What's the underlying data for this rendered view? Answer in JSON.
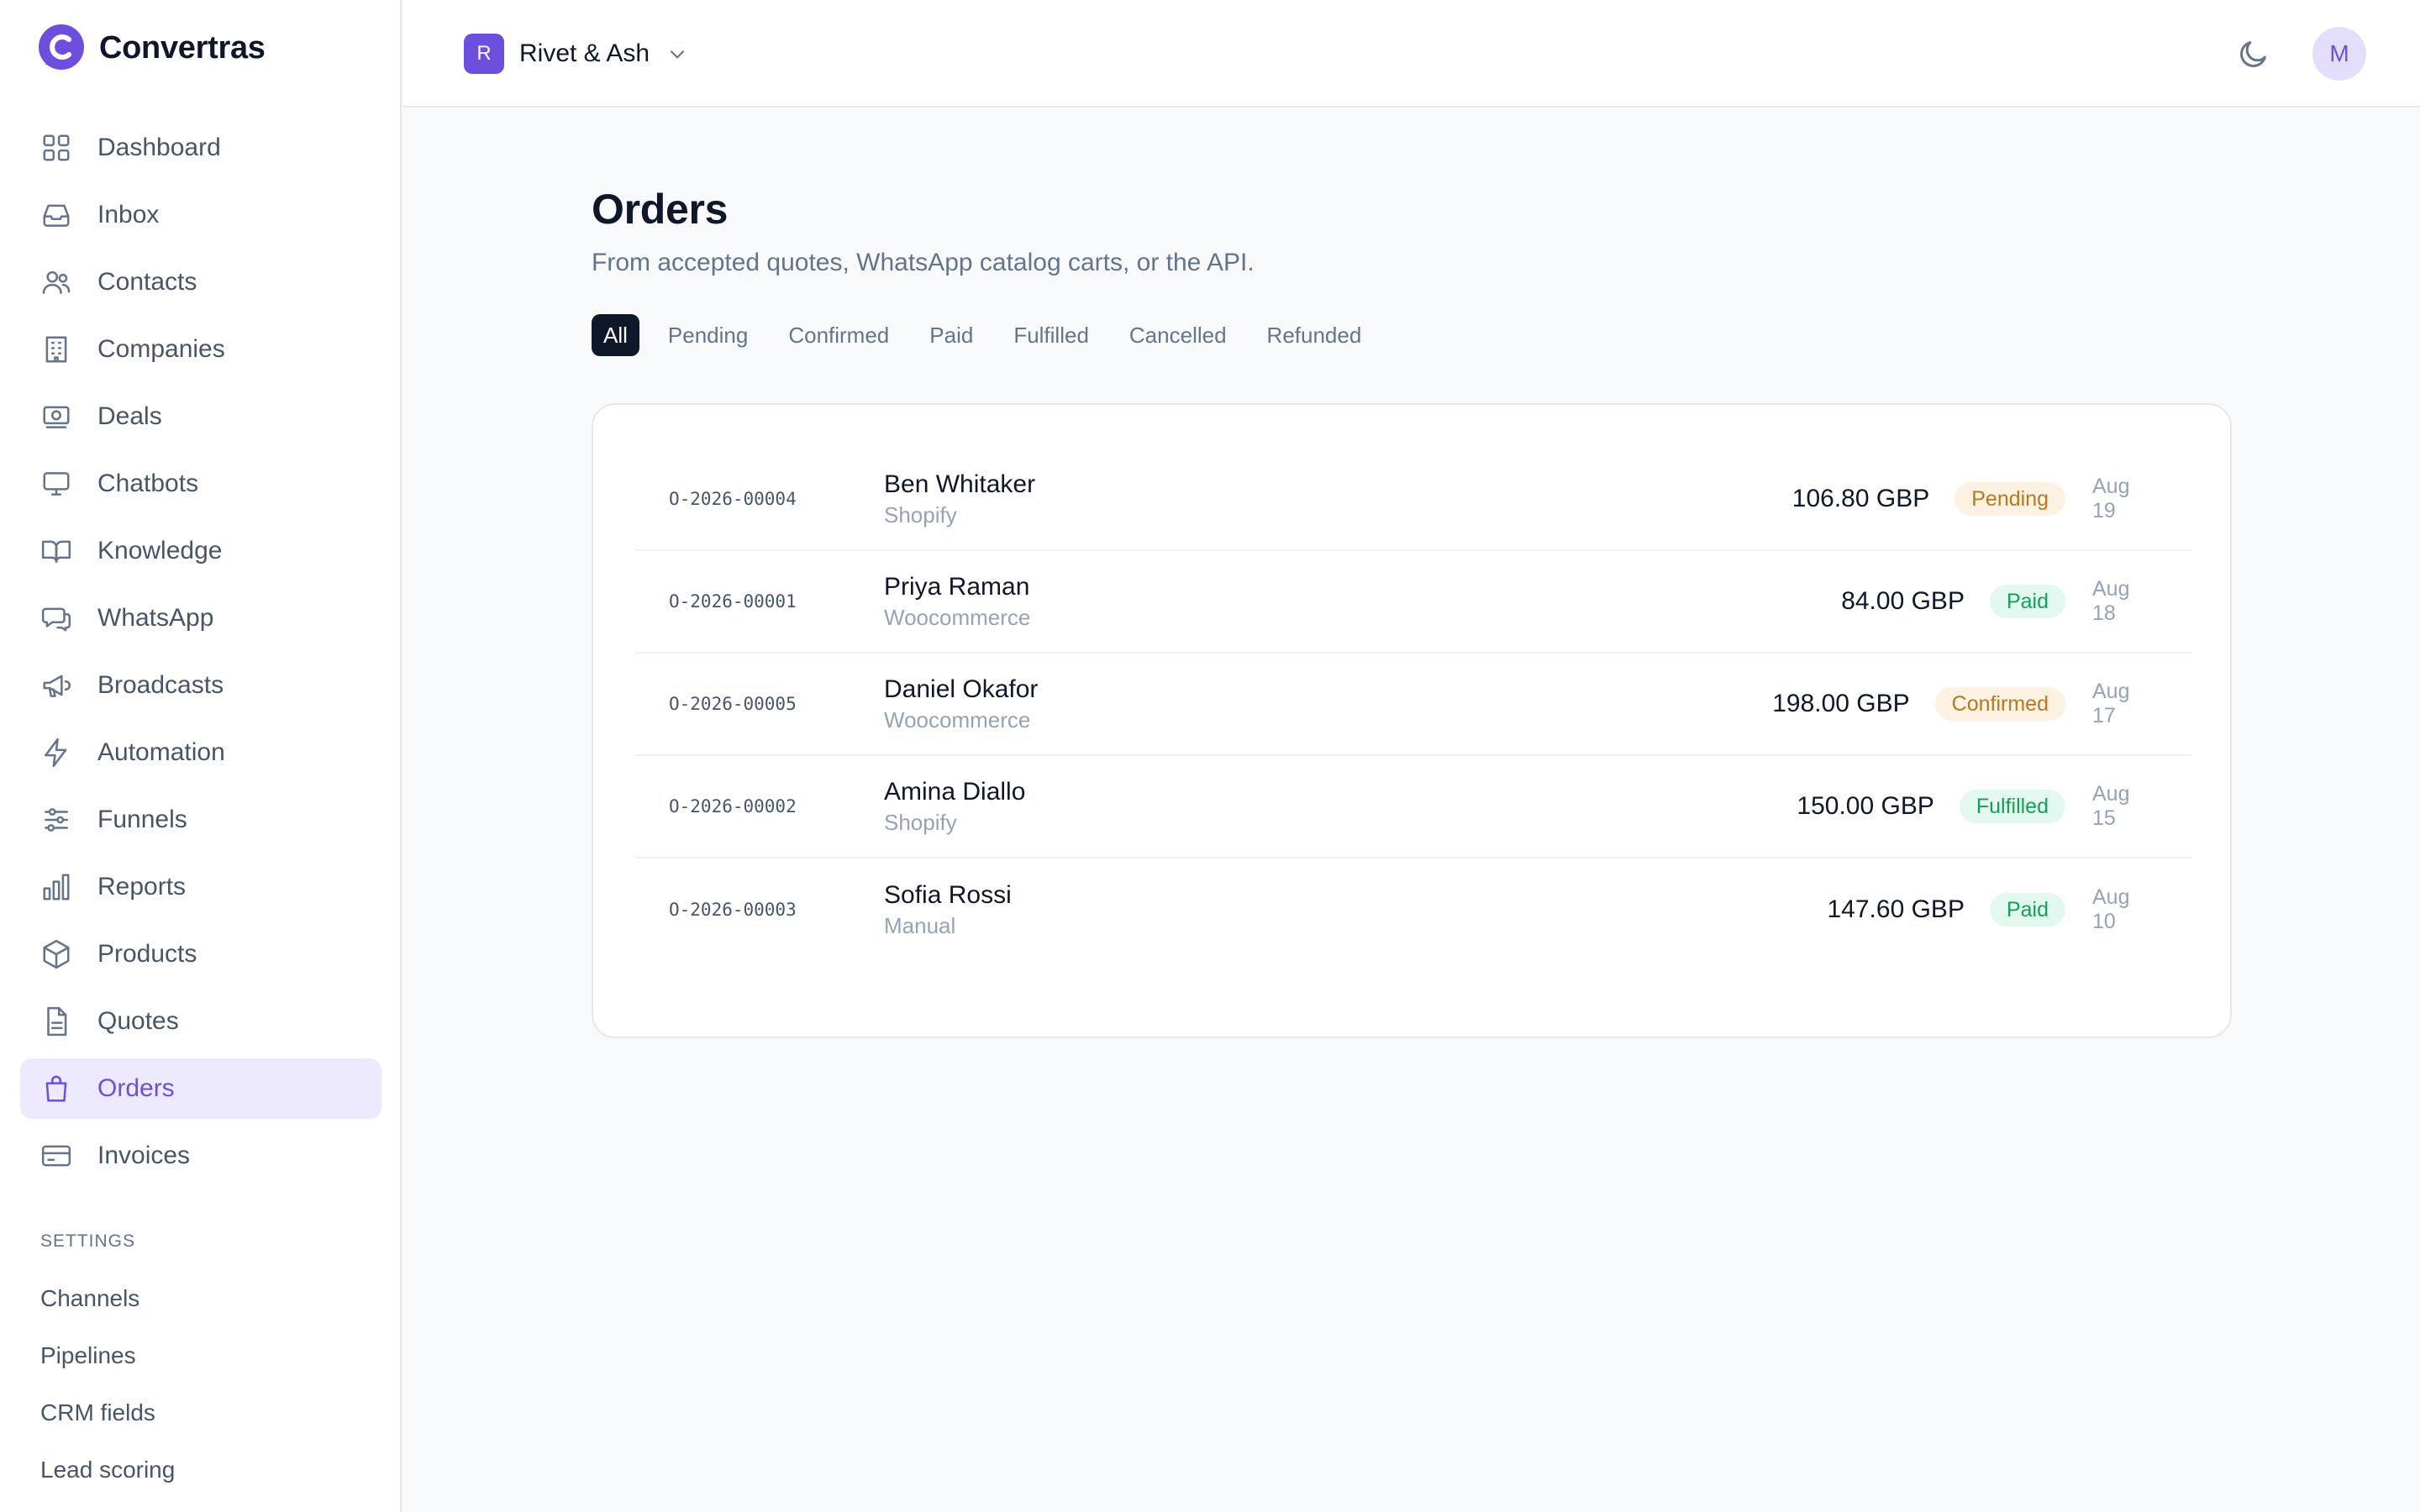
{
  "app": {
    "name": "Convertras"
  },
  "sidebar": {
    "items": [
      {
        "label": "Dashboard",
        "icon": "grid-icon"
      },
      {
        "label": "Inbox",
        "icon": "inbox-icon"
      },
      {
        "label": "Contacts",
        "icon": "users-icon"
      },
      {
        "label": "Companies",
        "icon": "building-icon"
      },
      {
        "label": "Deals",
        "icon": "money-icon"
      },
      {
        "label": "Chatbots",
        "icon": "monitor-icon"
      },
      {
        "label": "Knowledge",
        "icon": "book-icon"
      },
      {
        "label": "WhatsApp",
        "icon": "chat-icon"
      },
      {
        "label": "Broadcasts",
        "icon": "megaphone-icon"
      },
      {
        "label": "Automation",
        "icon": "lightning-icon"
      },
      {
        "label": "Funnels",
        "icon": "sliders-icon"
      },
      {
        "label": "Reports",
        "icon": "bar-chart-icon"
      },
      {
        "label": "Products",
        "icon": "box-icon"
      },
      {
        "label": "Quotes",
        "icon": "file-icon"
      },
      {
        "label": "Orders",
        "icon": "shopping-bag-icon",
        "active": true
      },
      {
        "label": "Invoices",
        "icon": "credit-card-icon"
      }
    ],
    "settings_title": "SETTINGS",
    "settings_items": [
      "Channels",
      "Pipelines",
      "CRM fields",
      "Lead scoring"
    ]
  },
  "topbar": {
    "workspace_initial": "R",
    "workspace_name": "Rivet & Ash",
    "avatar_initial": "M"
  },
  "page": {
    "title": "Orders",
    "subtitle": "From accepted quotes, WhatsApp catalog carts, or the API."
  },
  "tabs": [
    "All",
    "Pending",
    "Confirmed",
    "Paid",
    "Fulfilled",
    "Cancelled",
    "Refunded"
  ],
  "active_tab": "All",
  "orders": [
    {
      "id": "O-2026-00004",
      "customer": "Ben Whitaker",
      "source": "Shopify",
      "amount": "106.80 GBP",
      "status": "Pending",
      "date": "Aug 19"
    },
    {
      "id": "O-2026-00001",
      "customer": "Priya Raman",
      "source": "Woocommerce",
      "amount": "84.00 GBP",
      "status": "Paid",
      "date": "Aug 18"
    },
    {
      "id": "O-2026-00005",
      "customer": "Daniel Okafor",
      "source": "Woocommerce",
      "amount": "198.00 GBP",
      "status": "Confirmed",
      "date": "Aug 17"
    },
    {
      "id": "O-2026-00002",
      "customer": "Amina Diallo",
      "source": "Shopify",
      "amount": "150.00 GBP",
      "status": "Fulfilled",
      "date": "Aug 15"
    },
    {
      "id": "O-2026-00003",
      "customer": "Sofia Rossi",
      "source": "Manual",
      "amount": "147.60 GBP",
      "status": "Paid",
      "date": "Aug 10"
    }
  ],
  "status_colors": {
    "Pending": {
      "bg": "#fdf2e2",
      "fg": "#b7791f"
    },
    "Confirmed": {
      "bg": "#fdf2e2",
      "fg": "#b7791f"
    },
    "Paid": {
      "bg": "#e3f8ee",
      "fg": "#15a05a"
    },
    "Fulfilled": {
      "bg": "#e3f8ee",
      "fg": "#15a05a"
    }
  },
  "colors": {
    "accent": "#6d4fe0",
    "accent_soft": "#ede9fe",
    "text": "#0f172a",
    "muted": "#64748b"
  }
}
